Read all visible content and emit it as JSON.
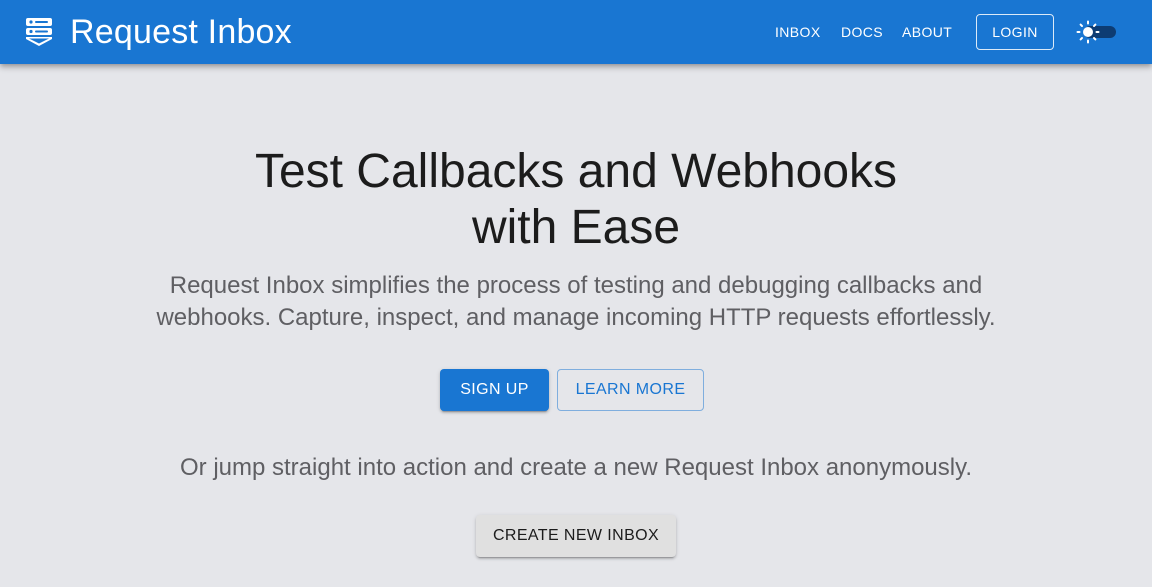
{
  "header": {
    "logo_icon": "server-stack-icon",
    "title": "Request Inbox",
    "nav": {
      "inbox": "INBOX",
      "docs": "DOCS",
      "about": "ABOUT"
    },
    "login_label": "LOGIN",
    "theme_toggle_icon": "sun-icon"
  },
  "hero": {
    "headline_line1": "Test Callbacks and Webhooks",
    "headline_line2": "with Ease",
    "subtitle_line1": "Request Inbox simplifies the process of testing and debugging callbacks and",
    "subtitle_line2": "webhooks. Capture, inspect, and manage incoming HTTP requests effortlessly.",
    "signup_label": "SIGN UP",
    "learn_more_label": "LEARN MORE",
    "jump_text": "Or jump straight into action and create a new Request Inbox anonymously.",
    "create_inbox_label": "CREATE NEW INBOX"
  },
  "colors": {
    "primary": "#1976d2",
    "background": "#e5e6ea",
    "toggle_track": "#0d3c73"
  }
}
